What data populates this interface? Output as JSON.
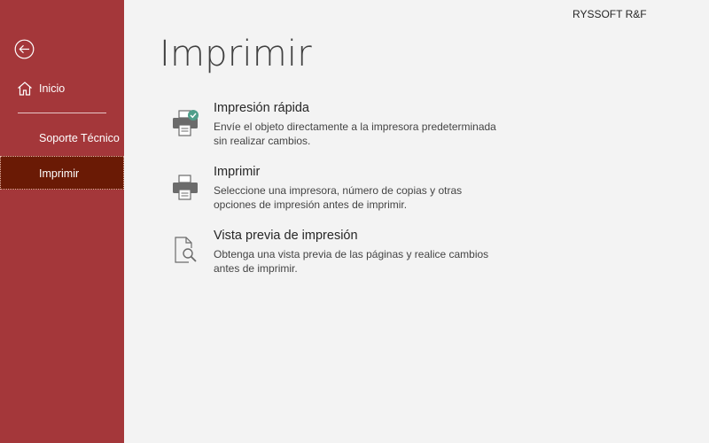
{
  "brand": "RYSSOFT R&F",
  "page_title": "Imprimir",
  "sidebar": {
    "back_icon": "arrow-left-circle-icon",
    "items": [
      {
        "label": "Inicio",
        "icon": "home-icon"
      },
      {
        "label": "Soporte Técnico"
      },
      {
        "label": "Imprimir",
        "selected": true
      }
    ]
  },
  "options": [
    {
      "title": "Impresión rápida",
      "description": "Envíe el objeto directamente a la impresora predeterminada sin realizar cambios.",
      "icon": "quick-print-icon"
    },
    {
      "title": "Imprimir",
      "description": "Seleccione una impresora, número de copias y otras opciones de impresión antes de imprimir.",
      "icon": "printer-icon"
    },
    {
      "title": "Vista previa de impresión",
      "description": "Obtenga una vista previa de las páginas y realice cambios antes de imprimir.",
      "icon": "print-preview-icon"
    }
  ],
  "colors": {
    "sidebar": "#a4373a",
    "sidebar_selected": "#6a1a05",
    "background": "#f3f3f3",
    "check_badge": "#4f9e8a"
  }
}
